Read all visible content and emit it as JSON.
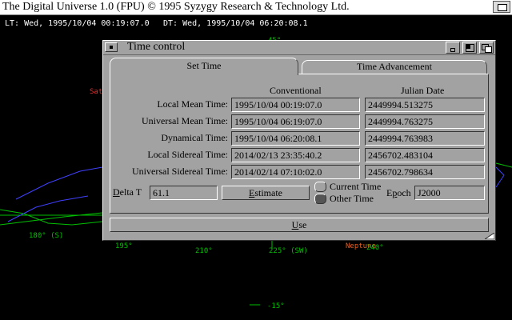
{
  "screen": {
    "title": "The Digital Universe 1.0 (FPU) © 1995 Syzygy Research & Technology Ltd."
  },
  "readout": {
    "lt": "LT: Wed, 1995/10/04 00:19:07.0",
    "dt": "DT: Wed, 1995/10/04 06:20:08.1"
  },
  "sky": {
    "labels": {
      "alt_top": "45°",
      "sat": "Sat",
      "az_180": "180° (S)",
      "az_195": "195°",
      "az_210": "210°",
      "az_225": "225° (SW)",
      "az_240": "240°",
      "neptune": "Neptune",
      "alt_minus15": "-15°"
    },
    "colors": {
      "green": "#00c000",
      "red": "#e03030",
      "orange": "#e06020"
    }
  },
  "window": {
    "title": "Time control",
    "tabs": [
      {
        "label": "Set Time",
        "active": true
      },
      {
        "label": "Time Advancement",
        "active": false
      }
    ],
    "columns": {
      "conventional": "Conventional",
      "julian": "Julian Date"
    },
    "rows": [
      {
        "label": "Local Mean Time:",
        "conventional": "1995/10/04 00:19:07.0",
        "julian": "2449994.513275"
      },
      {
        "label": "Universal Mean Time:",
        "conventional": "1995/10/04 06:19:07.0",
        "julian": "2449994.763275"
      },
      {
        "label": "Dynamical Time:",
        "conventional": "1995/10/04 06:20:08.1",
        "julian": "2449994.763983"
      },
      {
        "label": "Local Sidereal Time:",
        "conventional": "2014/02/13 23:35:40.2",
        "julian": "2456702.483104"
      },
      {
        "label": "Universal Sidereal Time:",
        "conventional": "2014/02/14 07:10:02.0",
        "julian": "2456702.798634"
      }
    ],
    "delta_t": {
      "label_first": "D",
      "label_rest": "elta T",
      "value": "61.1"
    },
    "estimate": {
      "label_first": "E",
      "label_rest": "stimate"
    },
    "radios": [
      {
        "label": "Current Time",
        "selected": false
      },
      {
        "label": "Other Time",
        "selected": true
      }
    ],
    "epoch": {
      "label_first": "E",
      "label_u": "p",
      "label_rest": "och",
      "value": "J2000"
    },
    "use": {
      "label_first": "U",
      "label_rest": "se"
    }
  }
}
